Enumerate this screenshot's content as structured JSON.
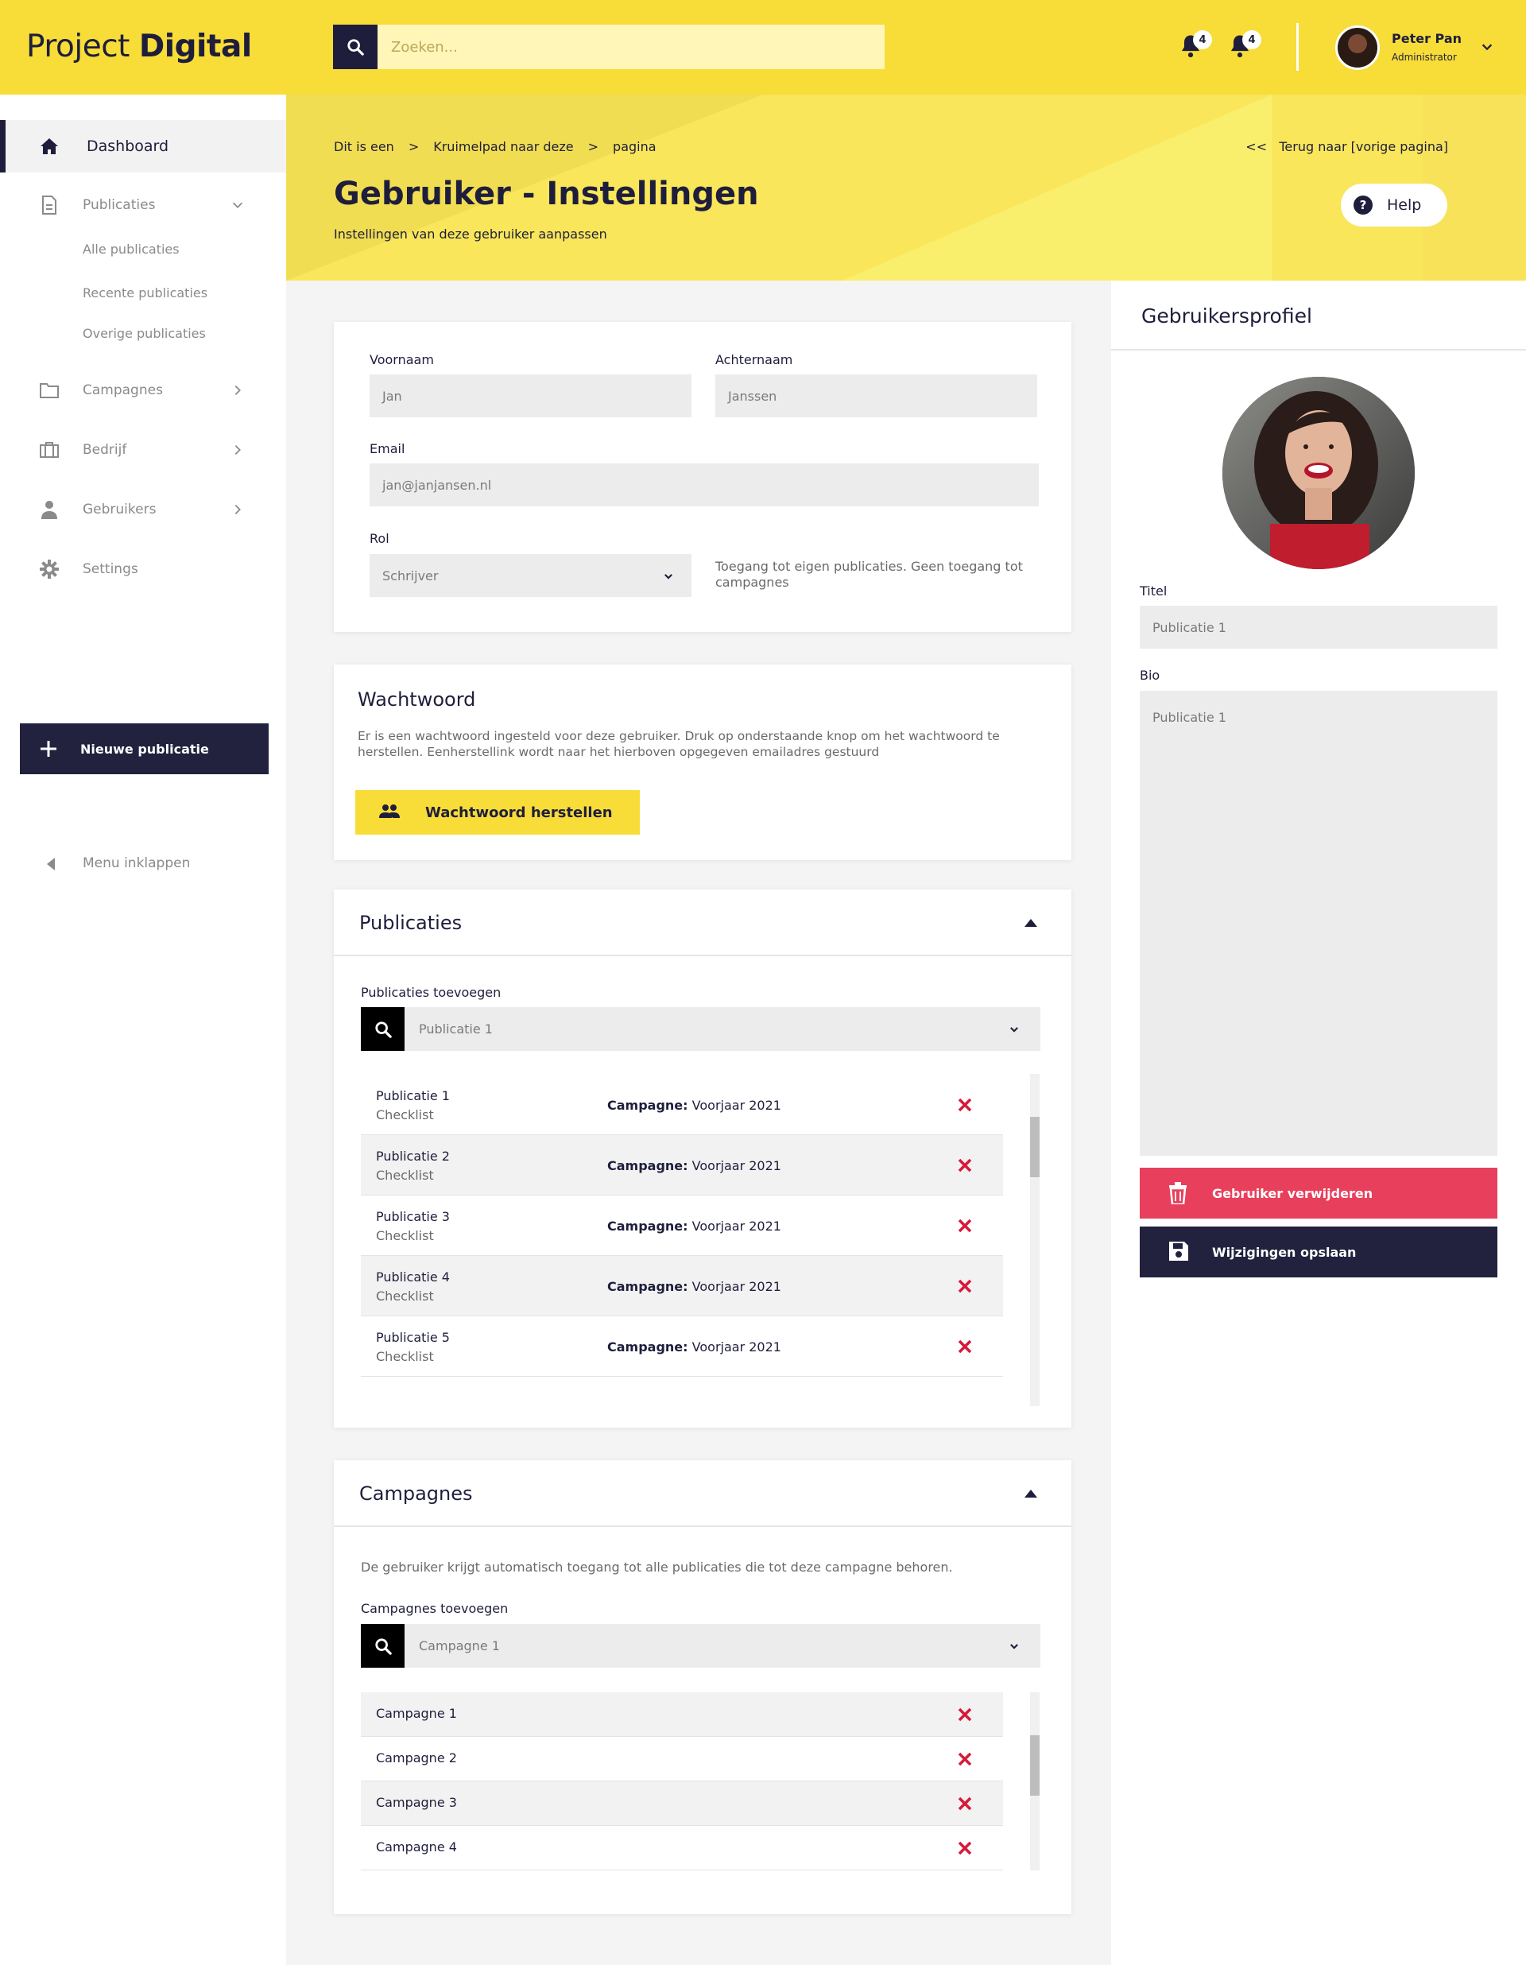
{
  "header": {
    "logo_light": "Project",
    "logo_bold": "Digital",
    "search_placeholder": "Zoeken...",
    "notifications": [
      {
        "count": "4"
      },
      {
        "count": "4"
      }
    ],
    "user": {
      "name": "Peter Pan",
      "role": "Administrator"
    }
  },
  "sidebar": {
    "items": [
      {
        "label": "Dashboard",
        "icon": "home-icon"
      },
      {
        "label": "Publicaties",
        "icon": "document-icon"
      },
      {
        "label": "Campagnes",
        "icon": "folder-icon"
      },
      {
        "label": "Bedrijf",
        "icon": "briefcase-icon"
      },
      {
        "label": "Gebruikers",
        "icon": "user-icon"
      },
      {
        "label": "Settings",
        "icon": "gear-icon"
      }
    ],
    "sub_items": [
      "Alle publicaties",
      "Recente publicaties",
      "Overige publicaties"
    ],
    "new_button": "Nieuwe publicatie",
    "collapse": "Menu inklappen"
  },
  "hero": {
    "breadcrumb": [
      "Dit is een",
      ">",
      "Kruimelpad naar deze",
      ">",
      "pagina"
    ],
    "back": "<<   Terug naar [vorige pagina]",
    "title": "Gebruiker - Instellingen",
    "subtitle": "Instellingen van deze gebruiker aanpassen",
    "help": "Help"
  },
  "form": {
    "first_name_label": "Voornaam",
    "first_name": "Jan",
    "last_name_label": "Achternaam",
    "last_name": "Janssen",
    "email_label": "Email",
    "email": "jan@janjansen.nl",
    "role_label": "Rol",
    "role": "Schrijver",
    "role_hint": "Toegang tot eigen publicaties. Geen toegang tot campagnes"
  },
  "password": {
    "title": "Wachtwoord",
    "text": "Er is een wachtwoord ingesteld voor deze gebruiker. Druk op onderstaande knop om het wachtwoord te herstellen. Eenherstellink wordt naar het hierboven opgegeven emailadres gestuurd",
    "button": "Wachtwoord herstellen"
  },
  "publications": {
    "title": "Publicaties",
    "add_label": "Publicaties toevoegen",
    "select_value": "Publicatie 1",
    "rows": [
      {
        "name": "Publicatie 1",
        "sub": "Checklist",
        "campaign_label": "Campagne:",
        "campaign": "Voorjaar 2021"
      },
      {
        "name": "Publicatie 2",
        "sub": "Checklist",
        "campaign_label": "Campagne:",
        "campaign": "Voorjaar 2021"
      },
      {
        "name": "Publicatie 3",
        "sub": "Checklist",
        "campaign_label": "Campagne:",
        "campaign": "Voorjaar 2021"
      },
      {
        "name": "Publicatie 4",
        "sub": "Checklist",
        "campaign_label": "Campagne:",
        "campaign": "Voorjaar 2021"
      },
      {
        "name": "Publicatie 5",
        "sub": "Checklist",
        "campaign_label": "Campagne:",
        "campaign": "Voorjaar 2021"
      }
    ]
  },
  "campaigns": {
    "title": "Campagnes",
    "text": "De gebruiker krijgt automatisch toegang tot alle publicaties die tot deze campagne behoren.",
    "add_label": "Campagnes toevoegen",
    "select_value": "Campagne 1",
    "rows": [
      "Campagne 1",
      "Campagne 2",
      "Campagne 3",
      "Campagne 4"
    ]
  },
  "profile": {
    "title": "Gebruikersprofiel",
    "titel_label": "Titel",
    "titel_value": "Publicatie 1",
    "bio_label": "Bio",
    "bio_value": "Publicatie 1",
    "delete_button": "Gebruiker verwijderen",
    "save_button": "Wijzigingen opslaan"
  },
  "colors": {
    "accent": "#f8dc38",
    "navy": "#1e1e3c",
    "danger": "#e8405c",
    "remove": "#d8193a"
  }
}
